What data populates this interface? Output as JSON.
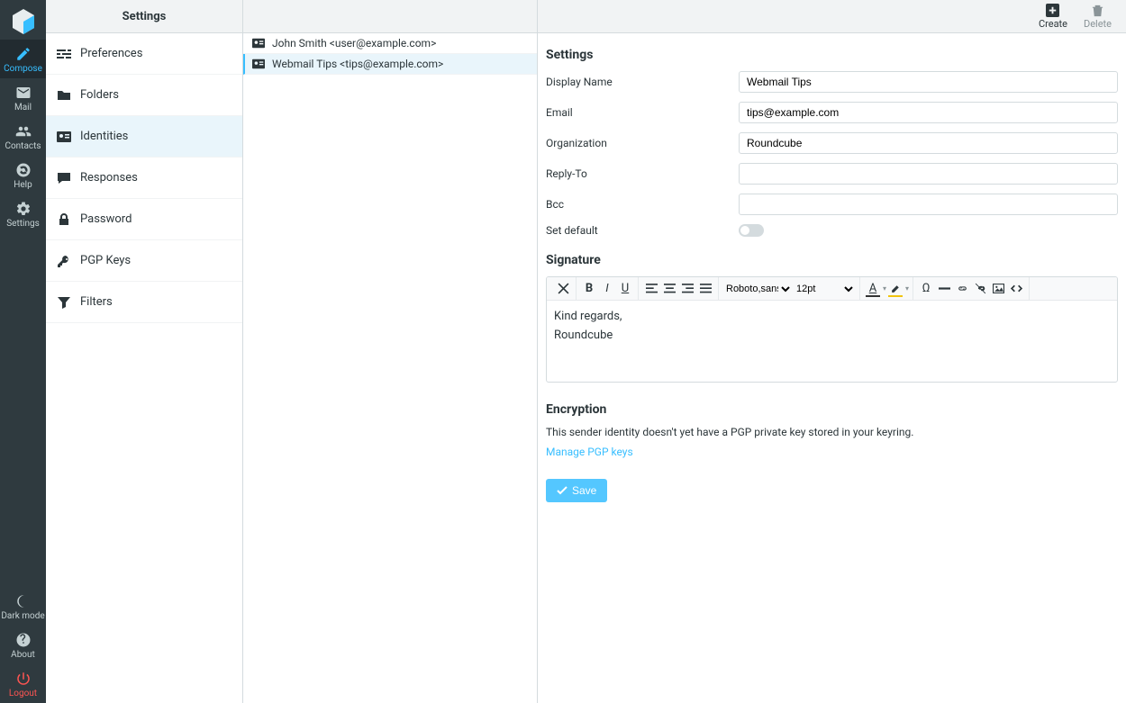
{
  "taskbar": {
    "compose": "Compose",
    "mail": "Mail",
    "contacts": "Contacts",
    "help": "Help",
    "settings": "Settings",
    "darkmode": "Dark mode",
    "about": "About",
    "logout": "Logout"
  },
  "settings_header": "Settings",
  "settings_nav": {
    "preferences": "Preferences",
    "folders": "Folders",
    "identities": "Identities",
    "responses": "Responses",
    "password": "Password",
    "pgpkeys": "PGP Keys",
    "filters": "Filters"
  },
  "identities": [
    {
      "label": "John Smith <user@example.com>"
    },
    {
      "label": "Webmail Tips <tips@example.com>"
    }
  ],
  "toolbar": {
    "create": "Create",
    "delete": "Delete"
  },
  "form": {
    "section_title": "Settings",
    "display_name_label": "Display Name",
    "display_name_value": "Webmail Tips",
    "email_label": "Email",
    "email_value": "tips@example.com",
    "org_label": "Organization",
    "org_value": "Roundcube",
    "replyto_label": "Reply-To",
    "replyto_value": "",
    "bcc_label": "Bcc",
    "bcc_value": "",
    "setdefault_label": "Set default"
  },
  "signature": {
    "title": "Signature",
    "font": "Roboto,sans-…",
    "size": "12pt",
    "line1": "Kind regards,",
    "line2": "Roundcube"
  },
  "encryption": {
    "title": "Encryption",
    "note": "This sender identity doesn't yet have a PGP private key stored in your keyring.",
    "link": "Manage PGP keys"
  },
  "save_label": "Save"
}
